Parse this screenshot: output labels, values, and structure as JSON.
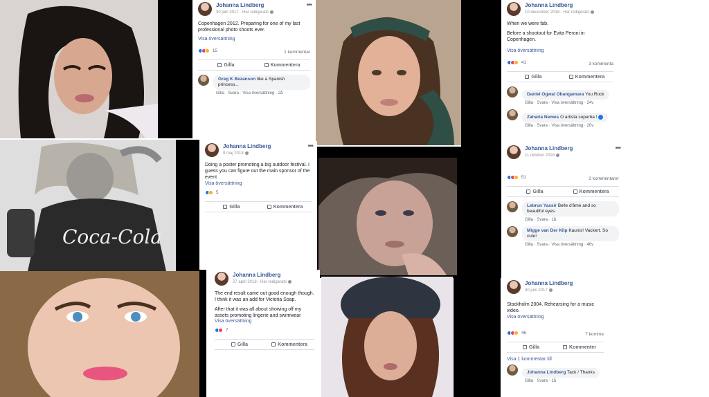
{
  "posts": [
    {
      "name": "Johanna Lindberg",
      "date": "30 juni 2017",
      "edited": "· Har redigerats",
      "body": [
        "Copenhagen 2012. Preparing for one of my last professional photo shoots ever."
      ],
      "translate": "Visa översättning",
      "reactions": "15",
      "comments_count": "1 kommentar",
      "like": "Gilla",
      "comment": "Kommentera",
      "comments": [
        {
          "author": "Greg K Bezanson",
          "text": "like a Spanish princess...",
          "meta": "Gilla · Svara · Visa översättning · 2å"
        }
      ]
    },
    {
      "name": "Johanna Lindberg",
      "date": "10 december 2018",
      "edited": "· Har redigerats",
      "body": [
        "When we were fab.",
        "Before a shootout for Evita Peroni in Copenhagen."
      ],
      "translate": "Visa översättning",
      "reactions": "41",
      "comments_count": "3 kommenta",
      "like": "Gilla",
      "comment": "Kommentera",
      "comments": [
        {
          "author": "Daniel Ogwal Obangamara",
          "text": "You Rock",
          "meta": "Gilla · Svara · Visa översättning · 24v"
        },
        {
          "author": "Zaharia Nemes",
          "text": "O artista superba !",
          "meta": "Gilla · Svara · Visa översättning · 20v"
        }
      ]
    },
    {
      "name": "Johanna Lindberg",
      "date": "9 maj 2018",
      "edited": "",
      "body": [
        "Doing a poster promoting a big outdoor festival. I guess you can figure out the main sponsor of the event"
      ],
      "translate": "Visa översättning",
      "reactions": "5",
      "comments_count": "",
      "like": "Gilla",
      "comment": "Kommentera",
      "comments": []
    },
    {
      "name": "Johanna Lindberg",
      "date": "11 oktober 2018",
      "edited": "",
      "body": [],
      "translate": "",
      "reactions": "51",
      "comments_count": "2 kommentarer",
      "like": "Gilla",
      "comment": "Kommentera",
      "comments": [
        {
          "author": "Lebrun Yassir",
          "text": "Belle d'âme and so beautiful eyes",
          "meta": "Gilla · Svara · 1å"
        },
        {
          "author": "Migge van Der Kilp",
          "text": "Kaunis! Vackert. So cute!",
          "meta": "Gilla · Svara · Visa översättning · 46v"
        }
      ]
    },
    {
      "name": "Johanna Lindberg",
      "date": "27 april 2018",
      "edited": "· Har redigerats",
      "body": [
        "The end result came out good enough though. I think it was an add for Victoria Soap.",
        "After that it was all about showing off my assets promoting lingerie and swimwear"
      ],
      "translate": "Visa översättning",
      "reactions": "7",
      "comments_count": "",
      "like": "Gilla",
      "comment": "Kommentera",
      "comments": []
    },
    {
      "name": "Johanna Lindberg",
      "date": "30 juni 2017",
      "edited": "",
      "body": [
        "Stockholm 2004. Rehearsing for a music video."
      ],
      "translate": "Visa översättning",
      "reactions": "46",
      "comments_count": "7 komme",
      "like": "Gilla",
      "comment": "Kommenter",
      "view_more": "Visa 1 kommentar till",
      "comments": [
        {
          "author": "Johanna Lindberg",
          "text": "Tack / Thanks",
          "meta": "Gilla · Svara · 1å"
        }
      ]
    }
  ],
  "photo_text": {
    "coca_cola": "Coca-Cola"
  }
}
